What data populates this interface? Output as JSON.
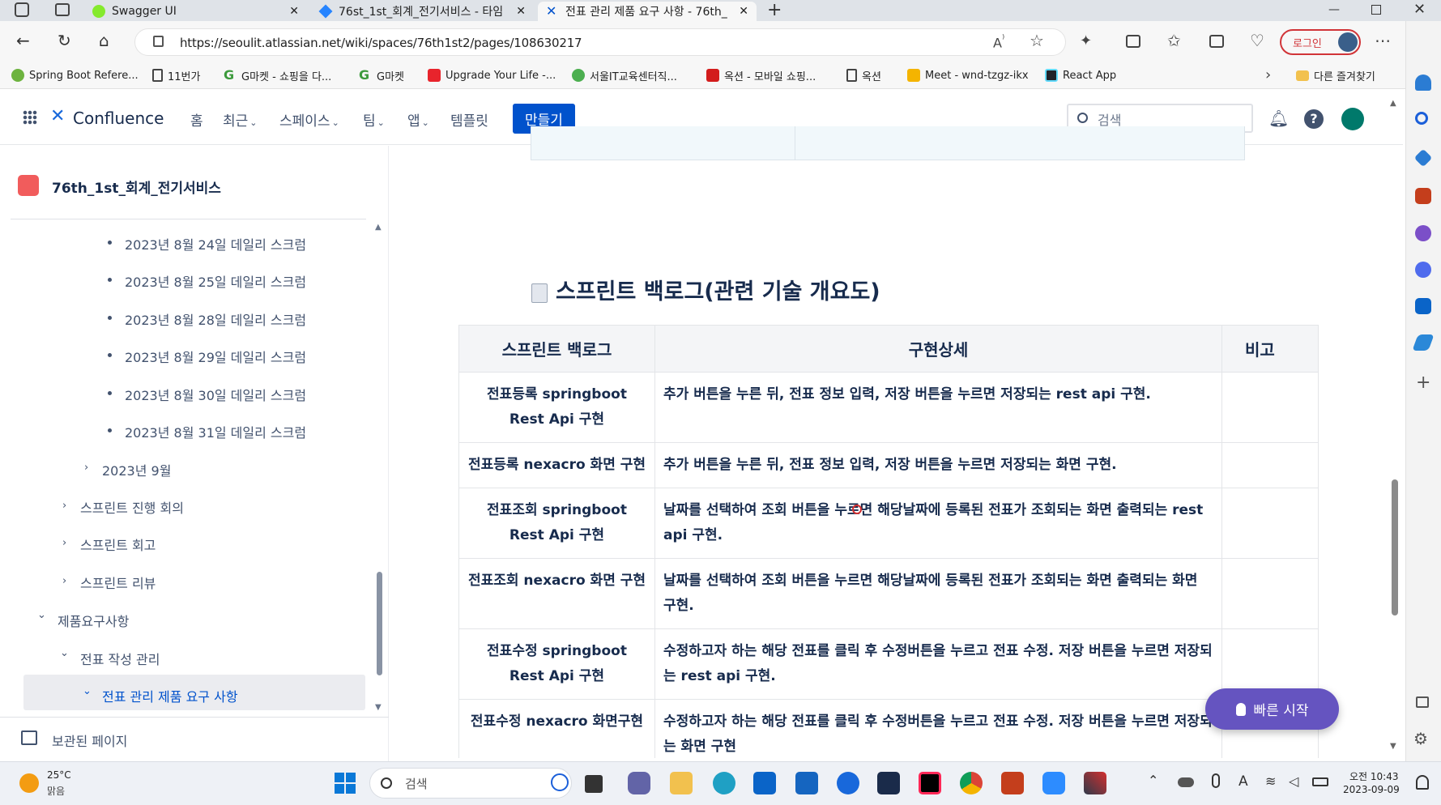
{
  "browser": {
    "tabs": [
      {
        "title": "Swagger UI",
        "active": false
      },
      {
        "title": "76st_1st_회계_전기서비스 - 타임",
        "active": false
      },
      {
        "title": "전표 관리 제품 요구 사항 - 76th_",
        "active": true
      }
    ],
    "url": "https://seoulit.atlassian.net/wiki/spaces/76th1st2/pages/108630217",
    "login_label": "로그인",
    "bookmarks": [
      "Spring Boot Refere...",
      "11번가",
      "G마켓 - 쇼핑을 다...",
      "G마켓",
      "Upgrade Your Life -...",
      "서울IT교육센터직...",
      "옥션 - 모바일 쇼핑...",
      "옥션",
      "Meet - wnd-tzgz-ikx",
      "React App"
    ],
    "other_favorites": "다른 즐겨찾기"
  },
  "header": {
    "product": "Confluence",
    "menu": [
      "홈",
      "최근",
      "스페이스",
      "팀",
      "앱",
      "템플릿"
    ],
    "create": "만들기",
    "search_placeholder": "검색"
  },
  "sidebar": {
    "space_name": "76th_1st_회계_전기서비스",
    "scrum_items": [
      "2023년 8월 24일 데일리 스크럼",
      "2023년 8월 25일 데일리 스크럼",
      "2023년 8월 28일 데일리 스크럼",
      "2023년 8월 29일 데일리 스크럼",
      "2023년 8월 30일 데일리 스크럼",
      "2023년 8월 31일 데일리 스크럼"
    ],
    "month": "2023년 9월",
    "folders": [
      "스프린트 진행 회의",
      "스프린트 회고",
      "스프린트 리뷰"
    ],
    "requirements": "제품요구사항",
    "doc_mgmt": "전표 작성 관리",
    "current_page": "전표 관리 제품 요구 사항",
    "archived": "보관된 페이지"
  },
  "main": {
    "section_title": "스프린트 백로그(관련 기술 개요도)",
    "table": {
      "headers": [
        "스프린트 백로그",
        "구현상세",
        "비고"
      ],
      "rows": [
        {
          "backlog": "전표등록 springboot Rest Api 구현",
          "detail": "추가 버튼을 누른 뒤, 전표 정보 입력, 저장 버튼을 누르면 저장되는 rest api 구현.",
          "note": ""
        },
        {
          "backlog": "전표등록 nexacro 화면 구현",
          "detail": "추가 버튼을 누른 뒤, 전표 정보 입력, 저장 버튼을 누르면 저장되는 화면 구현.",
          "note": ""
        },
        {
          "backlog": "전표조회 springboot Rest Api 구현",
          "detail": "날짜를 선택하여 조회 버튼을 누르면 해당날짜에 등록된 전표가 조회되는 화면 출력되는 rest api 구현.",
          "note": ""
        },
        {
          "backlog": "전표조회 nexacro 화면 구현",
          "detail": "날짜를 선택하여 조회 버튼을 누르면 해당날짜에 등록된 전표가 조회되는 화면 출력되는 화면 구현.",
          "note": ""
        },
        {
          "backlog": "전표수정 springboot Rest Api 구현",
          "detail": "수정하고자 하는 해당 전표를 클릭 후 수정버튼을 누르고 전표 수정. 저장 버튼을 누르면 저장되는 rest api 구현.",
          "note": ""
        },
        {
          "backlog": "전표수정 nexacro 화면구현",
          "detail": "수정하고자 하는 해당 전표를 클릭 후 수정버튼을 누르고 전표 수정. 저장 버튼을 누르면 저장되는 화면 구현",
          "note": ""
        }
      ]
    },
    "quick_start": "빠른 시작"
  },
  "taskbar": {
    "temperature": "25°C",
    "weather": "맑음",
    "search_placeholder": "검색",
    "time": "오전 10:43",
    "date": "2023-09-09"
  },
  "colors": {
    "brand": "#0052cc",
    "quick_start": "#6554c0",
    "sidebar_active_text": "#0052cc"
  }
}
